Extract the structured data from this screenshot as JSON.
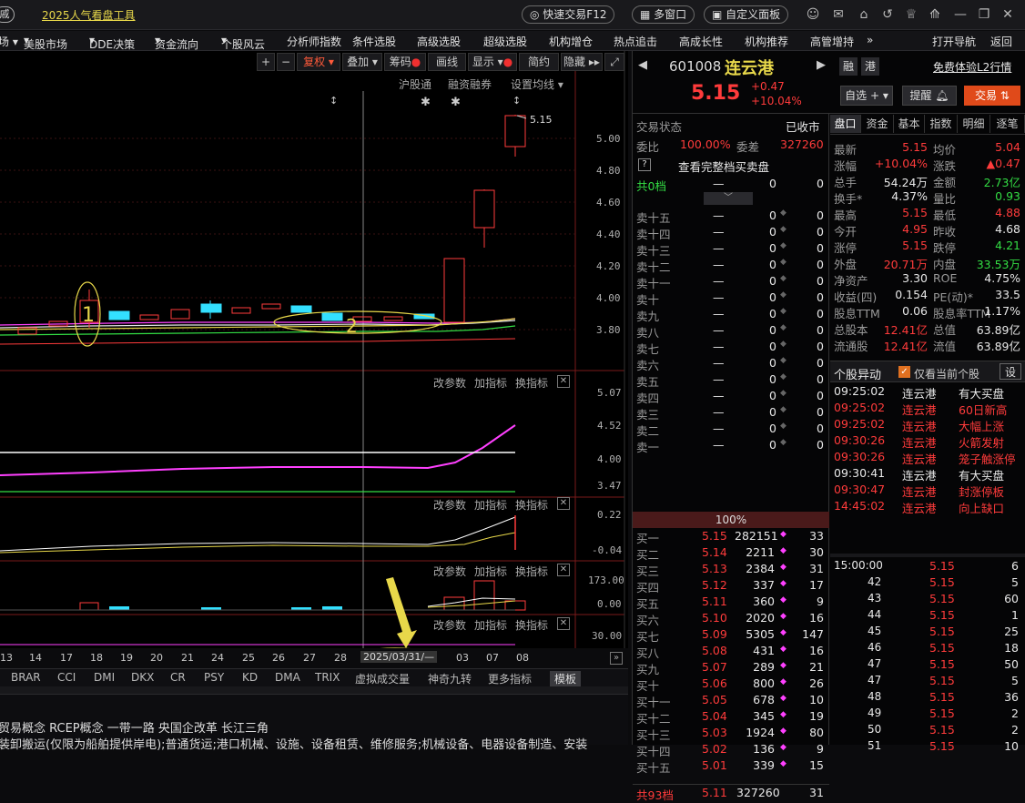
{
  "top": {
    "title": "2025人气看盘工具",
    "quick_trade": "快速交易F12",
    "multi_window": "多窗口",
    "custom_panel": "自定义面板"
  },
  "menu": [
    "美股市场",
    "DDE决策",
    "资金流向",
    "个股风云",
    "分析师指数",
    "条件选股",
    "高级选股",
    "超级选股",
    "机构增仓",
    "热点追击",
    "高成长性",
    "机构推荐",
    "高管增持",
    "打开导航",
    "返回"
  ],
  "chart_toolbar": {
    "plus": "+",
    "minus": "−",
    "fuquan": "复权",
    "overlay": "叠加",
    "chouma": "筹码",
    "draw": "画线",
    "display": "显示",
    "jianyue": "简约",
    "hide": "隐藏"
  },
  "chart_tags": {
    "hgt": "沪股通",
    "rzrq": "融资融券",
    "ma_setting": "设置均线",
    "last_price": "5.15",
    "mark1": "1",
    "mark2": "2"
  },
  "price_axis": [
    "5.00",
    "4.80",
    "4.60",
    "4.40",
    "4.20",
    "4.00",
    "3.80"
  ],
  "ind1_axis": [
    "5.07",
    "4.52",
    "4.00",
    "3.47"
  ],
  "ind2_axis": [
    "0.22",
    "-0.04"
  ],
  "ind3_axis": [
    "173.00",
    "0.00"
  ],
  "ind4_axis": [
    "30.00"
  ],
  "param_labels": {
    "change": "改参数",
    "add": "加指标",
    "swap": "换指标"
  },
  "x_dates": [
    "13",
    "14",
    "17",
    "18",
    "19",
    "20",
    "21",
    "24",
    "25",
    "26",
    "27",
    "28",
    "03",
    "07",
    "08"
  ],
  "crosshair_date": "2025/03/31/—",
  "indicators": [
    "BRAR",
    "CCI",
    "DMI",
    "DKX",
    "CR",
    "PSY",
    "KD",
    "DMA",
    "TRIX",
    "虚拟成交量",
    "神奇九转",
    "更多指标",
    "模板"
  ],
  "info_line1": "贸易概念  RCEP概念  一带一路  央国企改革  长江三角",
  "info_line2": "装卸搬运(仅限为船舶提供岸电);普通货运;港口机械、设施、设备租赁、维修服务;机械设备、电器设备制造、安装",
  "stock": {
    "code": "601008",
    "name": "连云港",
    "tag1": "融",
    "tag2": "港",
    "l2": "免费体验L2行情",
    "price": "5.15",
    "change": "+0.47",
    "pct": "+10.04%",
    "zixuan": "自选",
    "tixing": "提醒",
    "jiaoyi": "交易"
  },
  "status": {
    "label": "交易状态",
    "value": "已收市"
  },
  "weibi": {
    "label": "委比",
    "value": "100.00%",
    "diff_label": "委差",
    "diff": "327260"
  },
  "full_book": "查看完整档买卖盘",
  "sell_total": {
    "label": "共0档",
    "vol": "—",
    "v1": "0",
    "v2": "0"
  },
  "asks": [
    {
      "l": "卖十五",
      "p": "—",
      "v": "0"
    },
    {
      "l": "卖十四",
      "p": "—",
      "v": "0"
    },
    {
      "l": "卖十三",
      "p": "—",
      "v": "0"
    },
    {
      "l": "卖十二",
      "p": "—",
      "v": "0"
    },
    {
      "l": "卖十一",
      "p": "—",
      "v": "0"
    },
    {
      "l": "卖十",
      "p": "—",
      "v": "0"
    },
    {
      "l": "卖九",
      "p": "—",
      "v": "0"
    },
    {
      "l": "卖八",
      "p": "—",
      "v": "0"
    },
    {
      "l": "卖七",
      "p": "—",
      "v": "0"
    },
    {
      "l": "卖六",
      "p": "—",
      "v": "0"
    },
    {
      "l": "卖五",
      "p": "—",
      "v": "0"
    },
    {
      "l": "卖四",
      "p": "—",
      "v": "0"
    },
    {
      "l": "卖三",
      "p": "—",
      "v": "0"
    },
    {
      "l": "卖二",
      "p": "—",
      "v": "0"
    },
    {
      "l": "卖一",
      "p": "—",
      "v": "0"
    }
  ],
  "ratio_bar": "100%",
  "bids": [
    {
      "l": "买一",
      "p": "5.15",
      "v": "282151",
      "n": "33"
    },
    {
      "l": "买二",
      "p": "5.14",
      "v": "2211",
      "n": "30"
    },
    {
      "l": "买三",
      "p": "5.13",
      "v": "2384",
      "n": "31"
    },
    {
      "l": "买四",
      "p": "5.12",
      "v": "337",
      "n": "17"
    },
    {
      "l": "买五",
      "p": "5.11",
      "v": "360",
      "n": "9"
    },
    {
      "l": "买六",
      "p": "5.10",
      "v": "2020",
      "n": "16"
    },
    {
      "l": "买七",
      "p": "5.09",
      "v": "5305",
      "n": "147"
    },
    {
      "l": "买八",
      "p": "5.08",
      "v": "431",
      "n": "16"
    },
    {
      "l": "买九",
      "p": "5.07",
      "v": "289",
      "n": "21"
    },
    {
      "l": "买十",
      "p": "5.06",
      "v": "800",
      "n": "26"
    },
    {
      "l": "买十一",
      "p": "5.05",
      "v": "678",
      "n": "10"
    },
    {
      "l": "买十二",
      "p": "5.04",
      "v": "345",
      "n": "19"
    },
    {
      "l": "买十三",
      "p": "5.03",
      "v": "1924",
      "n": "80"
    },
    {
      "l": "买十四",
      "p": "5.02",
      "v": "136",
      "n": "9"
    },
    {
      "l": "买十五",
      "p": "5.01",
      "v": "339",
      "n": "15"
    }
  ],
  "buy_total": {
    "label": "共93档",
    "p": "5.11",
    "v": "327260",
    "n": "31"
  },
  "tabs": [
    "盘口",
    "资金",
    "基本",
    "指数",
    "明细",
    "逐笔"
  ],
  "quote": [
    [
      "最新",
      "5.15",
      "均价",
      "5.04"
    ],
    [
      "涨幅",
      "+10.04%",
      "涨跌",
      "▲0.47"
    ],
    [
      "总手",
      "54.24万",
      "金额",
      "2.73亿"
    ],
    [
      "换手*",
      "4.37%",
      "量比",
      "0.93"
    ],
    [
      "最高",
      "5.15",
      "最低",
      "4.88"
    ],
    [
      "今开",
      "4.95",
      "昨收",
      "4.68"
    ],
    [
      "涨停",
      "5.15",
      "跌停",
      "4.21"
    ],
    [
      "外盘",
      "20.71万",
      "内盘",
      "33.53万"
    ],
    [
      "净资产",
      "3.30",
      "ROE",
      "4.75%"
    ],
    [
      "收益(四)",
      "0.154",
      "PE(动)*",
      "33.5"
    ],
    [
      "股息TTM",
      "0.06",
      "股息率TTM",
      "1.17%"
    ],
    [
      "总股本",
      "12.41亿",
      "总值",
      "63.89亿"
    ],
    [
      "流通股",
      "12.41亿",
      "流值",
      "63.89亿"
    ]
  ],
  "yidong": {
    "title": "个股异动",
    "only_current": "仅看当前个股",
    "settings": "设"
  },
  "events": [
    {
      "t": "09:25:02",
      "n": "连云港",
      "e": "有大买盘"
    },
    {
      "t": "09:25:02",
      "n": "连云港",
      "e": "60日新高"
    },
    {
      "t": "09:25:02",
      "n": "连云港",
      "e": "大幅上涨"
    },
    {
      "t": "09:30:26",
      "n": "连云港",
      "e": "火箭发射"
    },
    {
      "t": "09:30:26",
      "n": "连云港",
      "e": "笼子触涨停"
    },
    {
      "t": "09:30:41",
      "n": "连云港",
      "e": "有大买盘"
    },
    {
      "t": "09:30:47",
      "n": "连云港",
      "e": "封涨停板"
    },
    {
      "t": "14:45:02",
      "n": "连云港",
      "e": "向上缺口"
    }
  ],
  "ticks": [
    {
      "t": "15:00:00",
      "p": "5.15",
      "v": "6"
    },
    {
      "t": "42",
      "p": "5.15",
      "v": "5"
    },
    {
      "t": "43",
      "p": "5.15",
      "v": "60"
    },
    {
      "t": "44",
      "p": "5.15",
      "v": "1"
    },
    {
      "t": "45",
      "p": "5.15",
      "v": "25"
    },
    {
      "t": "46",
      "p": "5.15",
      "v": "18"
    },
    {
      "t": "47",
      "p": "5.15",
      "v": "50"
    },
    {
      "t": "47",
      "p": "5.15",
      "v": "5"
    },
    {
      "t": "48",
      "p": "5.15",
      "v": "36"
    },
    {
      "t": "49",
      "p": "5.15",
      "v": "2"
    },
    {
      "t": "50",
      "p": "5.15",
      "v": "2"
    },
    {
      "t": "51",
      "p": "5.15",
      "v": "10"
    }
  ],
  "colors": {
    "up": "#ff3b3b",
    "down": "#33dd44",
    "flat": "#e8e8e8",
    "cyan": "#33c8ff",
    "orange": "#f07020",
    "panel_bg": "#050506"
  }
}
